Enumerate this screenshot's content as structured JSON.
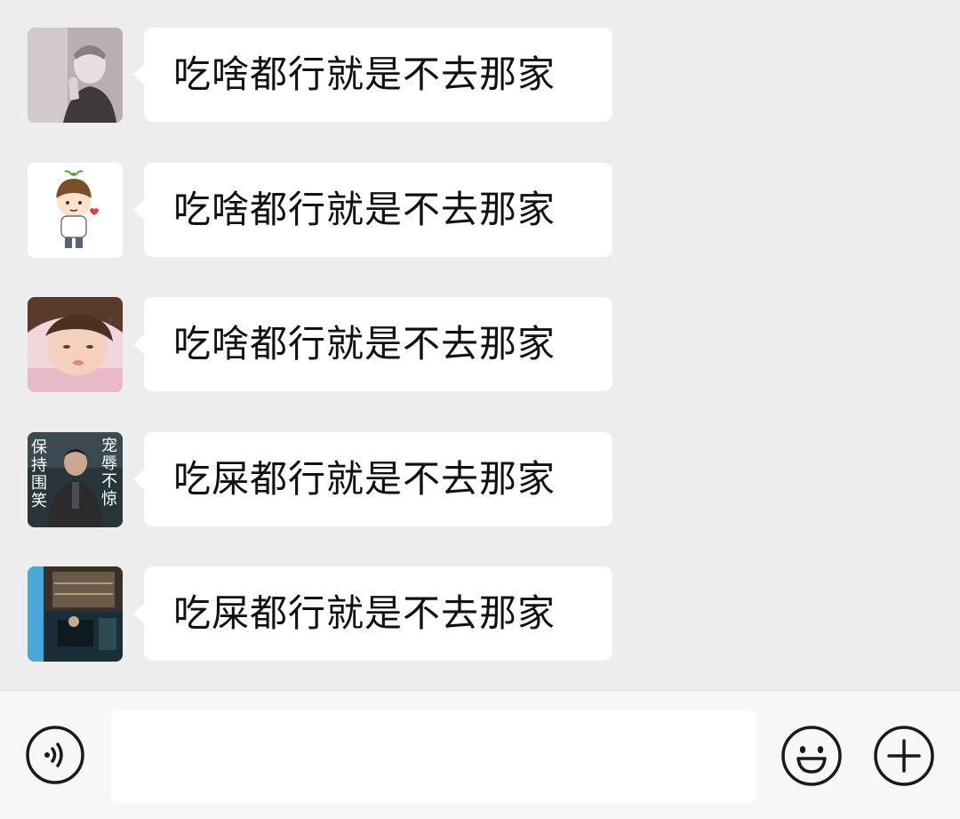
{
  "messages": [
    {
      "text": "吃啥都行就是不去那家",
      "avatar": "avatar-man-portrait"
    },
    {
      "text": "吃啥都行就是不去那家",
      "avatar": "avatar-cartoon-boy"
    },
    {
      "text": "吃啥都行就是不去那家",
      "avatar": "avatar-child-photo"
    },
    {
      "text": "吃屎都行就是不去那家",
      "avatar": "avatar-meme-poster",
      "avatar_caption_left": "保持围笑",
      "avatar_caption_right": "宠辱不惊"
    },
    {
      "text": "吃屎都行就是不去那家",
      "avatar": "avatar-room-photo"
    }
  ],
  "input_bar": {
    "voice_icon": "voice-icon",
    "input_value": "",
    "emoji_icon": "emoji-icon",
    "plus_icon": "plus-icon"
  },
  "colors": {
    "background": "#ededed",
    "bubble": "#ffffff",
    "input_bar": "#f7f7f7",
    "icon": "#1a1a1a"
  }
}
